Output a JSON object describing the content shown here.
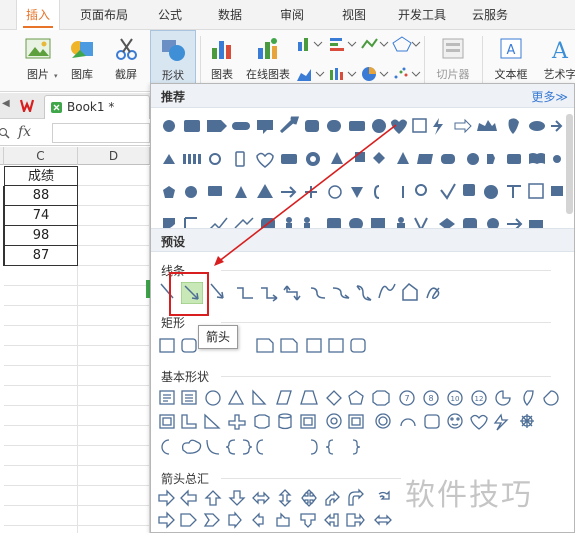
{
  "menu": {
    "tabs": [
      {
        "label": "插入",
        "active": true
      },
      {
        "label": "页面布局"
      },
      {
        "label": "公式"
      },
      {
        "label": "数据"
      },
      {
        "label": "审阅"
      },
      {
        "label": "视图"
      },
      {
        "label": "开发工具"
      },
      {
        "label": "云服务"
      }
    ]
  },
  "ribbon": {
    "picture": "图片",
    "gallery": "图库",
    "screenshot": "截屏",
    "shapes": "形状",
    "chart": "图表",
    "online_chart": "在线图表",
    "clipart": "切片器",
    "textbox": "文本框",
    "art": "艺术字"
  },
  "document": {
    "tab": "Book1 *"
  },
  "formula": {
    "fx": "fx"
  },
  "sheet": {
    "columns": [
      "C",
      "D"
    ],
    "header_cell": "成绩",
    "values": [
      "88",
      "74",
      "98",
      "87"
    ]
  },
  "shapes_panel": {
    "recommended": "推荐",
    "more": "更多≫",
    "presets": "预设",
    "lines": "线条",
    "rectangles": "矩形",
    "basic_shapes": "基本形状",
    "block_arrows": "箭头总汇",
    "tooltip": "箭头",
    "accent_color": "#4e6e96",
    "highlight_color": "#d81e1e"
  },
  "watermark": "软件技巧"
}
